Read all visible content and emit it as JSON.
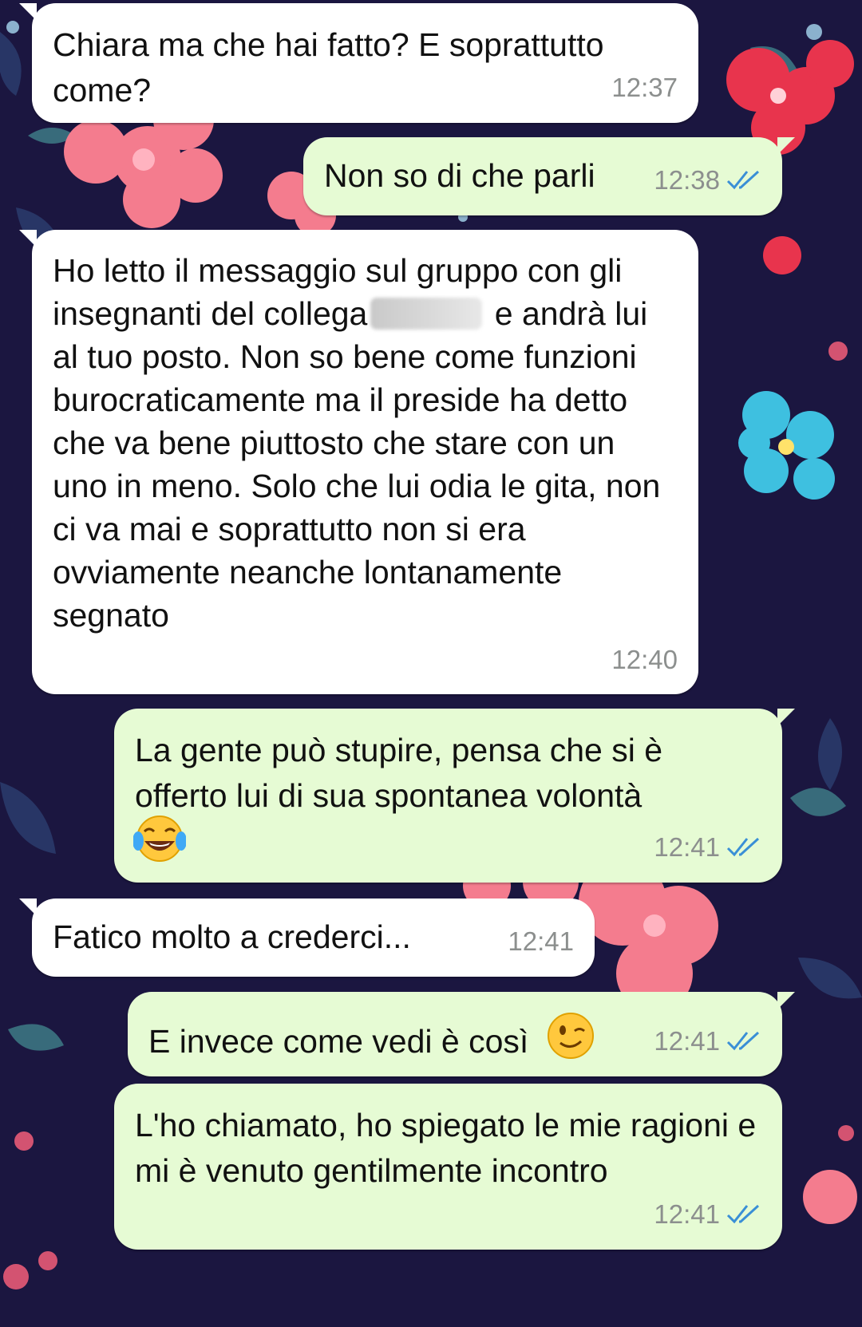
{
  "colors": {
    "background": "#1b1640",
    "incoming_bubble": "#ffffff",
    "outgoing_bubble": "#e6fbd4",
    "timestamp": "#8c8f8e",
    "read_ticks": "#3a8fd6"
  },
  "messages": [
    {
      "direction": "in",
      "text": "Chiara ma che hai fatto? E soprattutto come?",
      "time": "12:37"
    },
    {
      "direction": "out",
      "text": "Non so di che parli",
      "time": "12:38",
      "status": "read"
    },
    {
      "direction": "in",
      "text_before_redaction": "Ho letto il messaggio sul gruppo con gli insegnanti del collega",
      "text_after_redaction": "e andrà lui al tuo posto. Non so bene come funzioni burocraticamente ma il preside ha detto che va bene piuttosto che stare con un uno in meno. Solo che lui odia le gita, non ci va mai e soprattutto non si era ovviamente neanche lontanamente segnato",
      "time": "12:40"
    },
    {
      "direction": "out",
      "text": "La gente può stupire, pensa che si è offerto lui di sua spontanea volontà",
      "emoji": "face-with-tears-of-joy-icon",
      "time": "12:41",
      "status": "read"
    },
    {
      "direction": "in",
      "text": "Fatico molto a crederci...",
      "time": "12:41"
    },
    {
      "direction": "out",
      "text": "E invece come vedi è così",
      "emoji": "winking-face-icon",
      "time": "12:41",
      "status": "read"
    },
    {
      "direction": "out",
      "text": "L'ho chiamato, ho spiegato le mie ragioni e mi è venuto gentilmente incontro",
      "time": "12:41",
      "status": "read"
    }
  ]
}
